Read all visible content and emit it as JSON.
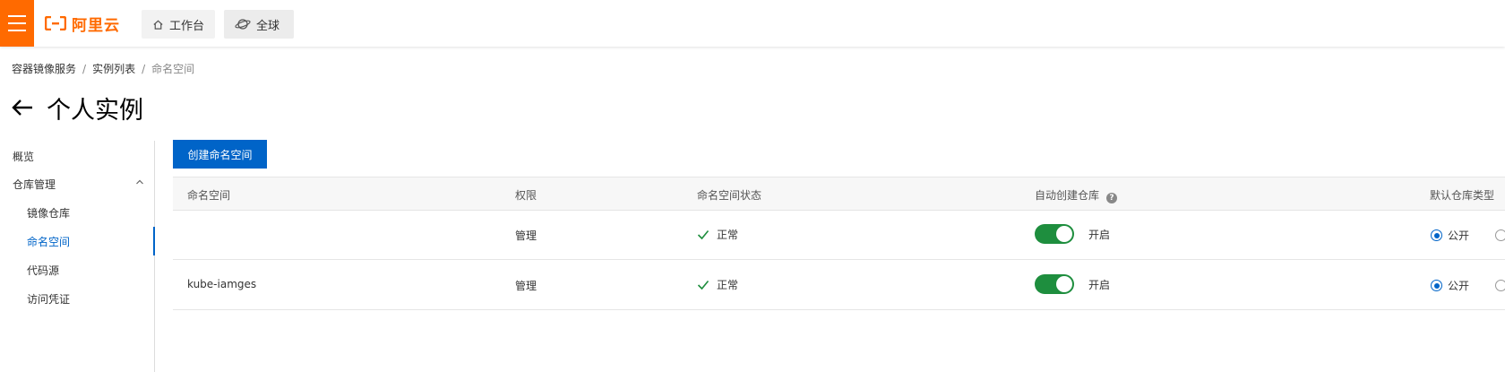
{
  "header": {
    "logo_text": "阿里云",
    "workbench_label": "工作台",
    "global_label": "全球"
  },
  "breadcrumb": {
    "items": [
      "容器镜像服务",
      "实例列表",
      "命名空间"
    ]
  },
  "page": {
    "title": "个人实例"
  },
  "sidebar": {
    "overview": "概览",
    "repo_management": "仓库管理",
    "items": [
      "镜像仓库",
      "命名空间",
      "代码源",
      "访问凭证"
    ],
    "active_index": 1
  },
  "toolbar": {
    "create_label": "创建命名空间"
  },
  "table": {
    "headers": [
      "命名空间",
      "权限",
      "命名空间状态",
      "自动创建仓库",
      "默认仓库类型"
    ],
    "rows": [
      {
        "namespace": "",
        "permission": "管理",
        "status": "正常",
        "auto_create": "开启",
        "auto_create_on": true,
        "default_type": "公开"
      },
      {
        "namespace": "kube-iamges",
        "permission": "管理",
        "status": "正常",
        "auto_create": "开启",
        "auto_create_on": true,
        "default_type": "公开"
      }
    ]
  },
  "colors": {
    "brand": "#ff6a00",
    "primary": "#0064c8",
    "toggle_on": "#1e8e3e",
    "status_ok": "#1e8e3e"
  }
}
